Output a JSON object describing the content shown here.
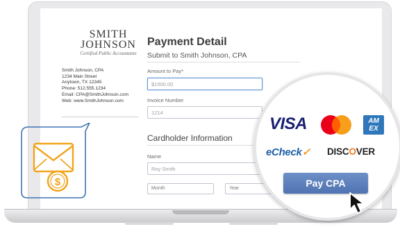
{
  "company": {
    "logo_line1": "SMITH",
    "logo_line2": "JOHNSON",
    "logo_tagline": "Certified Public Accountants",
    "name": "Smith Johnson, CPA",
    "street": "1234 Main Street",
    "city": "Anytown, TX 12345",
    "phone": "Phone: 512.555.1234",
    "email": "Email:  CPA@SmithJohnson.com",
    "web": "Web:  www.SmithJohnson.com"
  },
  "form": {
    "title": "Payment Detail",
    "subtitle": "Submit to Smith Johnson, CPA",
    "amount_label": "Amount to Pay*",
    "amount_value": "$1500.00",
    "invoice_label": "Invoice Number",
    "invoice_value": "1214",
    "cardholder_title": "Cardholder Information",
    "name_label": "Name",
    "name_value": "Roy Smith",
    "month_label": "Month",
    "year_label": "Year"
  },
  "payment_methods": {
    "visa": "VISA",
    "amex_line1": "AM",
    "amex_line2": "EX",
    "echeck_prefix": "eCheck",
    "discover_prefix": "DISC",
    "discover_o": "O",
    "discover_suffix": "VER",
    "pay_button": "Pay CPA"
  },
  "colors": {
    "accent_blue": "#5a7bbd",
    "envelope_orange": "#f2a31b",
    "bubble_blue": "#3f73b5",
    "visa_navy": "#1a1f71"
  }
}
